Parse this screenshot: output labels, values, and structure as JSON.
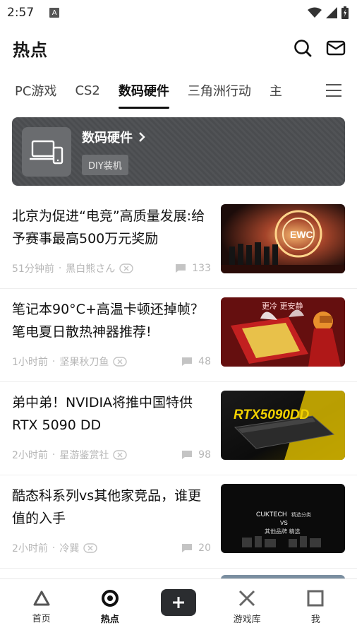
{
  "status_bar": {
    "time": "2:57",
    "sim_badge": "A"
  },
  "header": {
    "title": "热点"
  },
  "tabs": [
    {
      "label": "PC游戏"
    },
    {
      "label": "CS2"
    },
    {
      "label": "数码硬件",
      "active": true
    },
    {
      "label": "三角洲行动"
    },
    {
      "label": "主"
    }
  ],
  "category_card": {
    "title": "数码硬件",
    "tag": "DIY装机"
  },
  "news": [
    {
      "title": "北京为促进“电竞”高质量发展:给予赛事最高500万元奖励",
      "time": "51分钟前",
      "author": "黑白熊さん",
      "comments": "133",
      "thumb_icon": "esports-stage-image"
    },
    {
      "title": "笔记本90°C+高温卡顿还掉帧？笔电夏日散热神器推荐!",
      "time": "1小时前",
      "author": "坚果秋刀鱼",
      "comments": "48",
      "thumb_icon": "laptop-cooler-image",
      "thumb_text": "更冷 更安静"
    },
    {
      "title": "弟中弟！NVIDIA将推中国特供RTX 5090 DD",
      "time": "2小时前",
      "author": "星游鉴赏社",
      "comments": "98",
      "thumb_icon": "rtx-gpu-image",
      "thumb_text": "RTX5090DD"
    },
    {
      "title": "酷态科系列vs其他家竞品，谁更值的入手",
      "time": "2小时前",
      "author": "冷巽",
      "comments": "20",
      "thumb_icon": "powerbank-compare-image",
      "thumb_text_1": "CUKTECH",
      "thumb_text_2": "精选分类",
      "thumb_text_3": "VS",
      "thumb_text_4": "其他品牌 精选"
    }
  ],
  "bottom_nav": [
    {
      "label": "首页",
      "icon": "triangle-icon"
    },
    {
      "label": "热点",
      "icon": "circle-icon",
      "active": true
    },
    {
      "label": "",
      "icon": "plus-icon"
    },
    {
      "label": "游戏库",
      "icon": "cross-icon"
    },
    {
      "label": "我",
      "icon": "square-icon"
    }
  ],
  "colors": {
    "accent": "#111111",
    "card_bg": "#4d4f52",
    "meta": "#b6b6b6"
  }
}
